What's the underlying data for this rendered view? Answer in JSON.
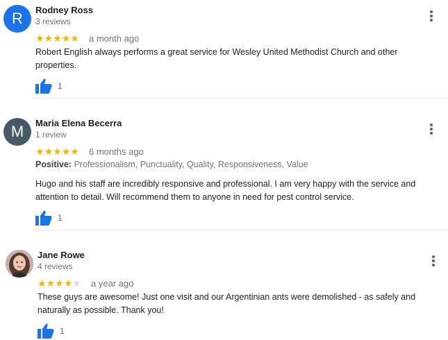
{
  "reviews": [
    {
      "initial": "R",
      "avatar_color": "#1a73e8",
      "name": "Rodney Ross",
      "count": "3 reviews",
      "rating": 5,
      "time": "a month ago",
      "text": "Robert English always performs a great service for Wesley United Methodist Church and other properties.",
      "likes": "1"
    },
    {
      "initial": "M",
      "avatar_color": "#455a64",
      "name": "Maria Elena Becerra",
      "count": "1 review",
      "rating": 5,
      "time": "6 months ago",
      "positive_label": "Positive:",
      "positive_values": "Professionalism, Punctuality, Quality, Responsiveness, Value",
      "text": "Hugo and his staff are incredibly responsive and professional.  I am very happy with the service and attention to detail.  Will recommend them to anyone in need for pest control service.",
      "likes": "1"
    },
    {
      "avatar": "photo",
      "name": "Jane Rowe",
      "count": "4 reviews",
      "rating": 4,
      "time": "a year ago",
      "text": "These guys are awesome! Just one visit and our Argentinian ants were demolished - as safely and naturally as possible. Thank you!",
      "likes": "1"
    }
  ],
  "icons": {
    "like": "thumbs-up-icon",
    "more": "more-vert-icon",
    "star": "star-icon"
  },
  "colors": {
    "star": "#f5b400",
    "like": "#1a73e8"
  }
}
